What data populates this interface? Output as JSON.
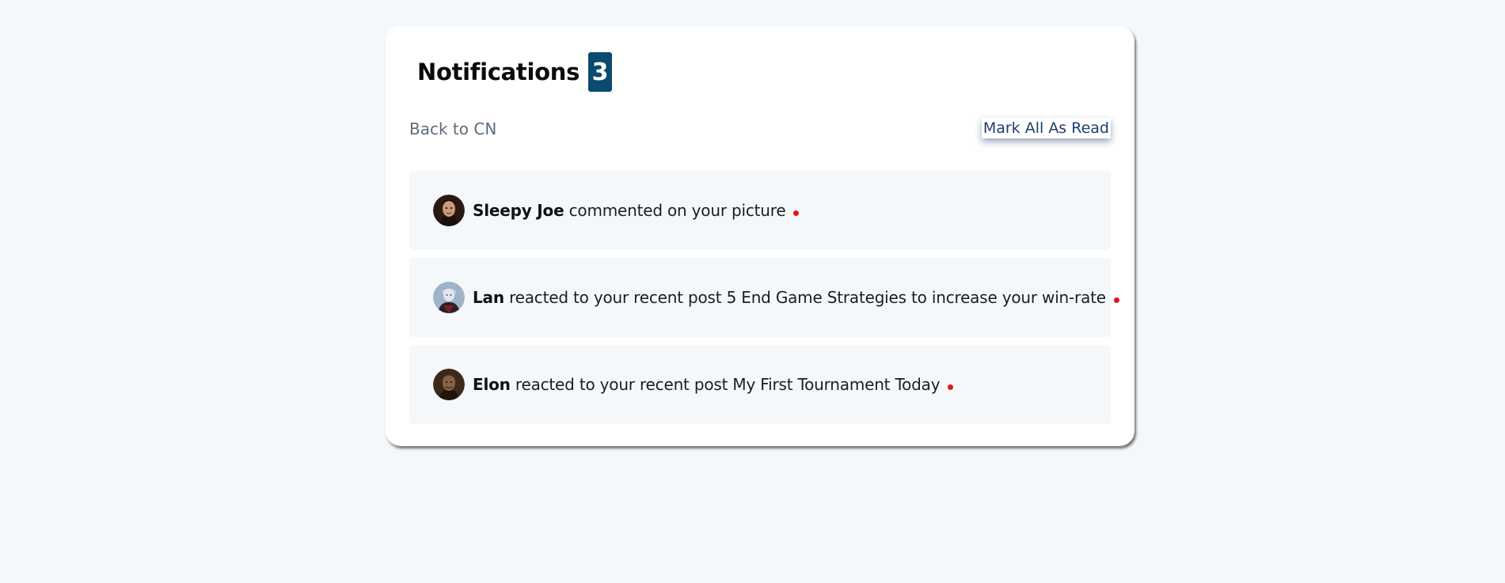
{
  "header": {
    "title": "Notifications",
    "count": "3"
  },
  "actions": {
    "back_label": "Back to CN",
    "mark_all_label": "Mark All As Read"
  },
  "notifications": [
    {
      "name": "Sleepy Joe",
      "action": "commented on your picture",
      "unread": true,
      "avatar_icon": "user-avatar-dark-hooded-icon"
    },
    {
      "name": "Lan",
      "action": "reacted to your recent post 5 End Game Strategies to increase your win-rate",
      "unread": true,
      "avatar_icon": "user-avatar-light-icon"
    },
    {
      "name": "Elon",
      "action": "reacted to your recent post My First Tournament Today",
      "unread": true,
      "avatar_icon": "user-avatar-brown-icon"
    }
  ],
  "colors": {
    "badge_bg": "#0c4a6e",
    "unread_dot": "#e11515",
    "page_bg": "#f5f8fb",
    "link": "#1c3f6e"
  }
}
